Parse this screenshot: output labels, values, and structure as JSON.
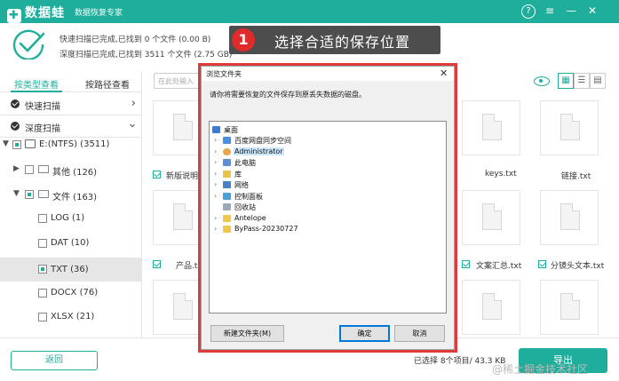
{
  "app": {
    "name": "数据蛙",
    "subtitle": "数据恢复专家"
  },
  "window_controls": {
    "help": "?",
    "menu": "≡",
    "minimize": "—",
    "close": "✕"
  },
  "scan": {
    "quick_status": "快速扫描已完成,已找到 0 个文件 (0.00  B)",
    "deep_status": "深度扫描已完成,已找到 3511 个文件 (2.75 GB)"
  },
  "callout": {
    "number": "1",
    "text": "选择合适的保存位置"
  },
  "sidebar": {
    "tabs": [
      "按类型查看",
      "按路径查看"
    ],
    "quick_scan": "快速扫描",
    "deep_scan": "深度扫描",
    "tree": [
      {
        "label": "E:(NTFS) (3511)"
      },
      {
        "label": "其他 (126)"
      },
      {
        "label": "文件 (163)"
      },
      {
        "label": "LOG (1)"
      },
      {
        "label": "DAT (10)"
      },
      {
        "label": "TXT (36)"
      },
      {
        "label": "DOCX (76)"
      },
      {
        "label": "XLSX (21)"
      }
    ]
  },
  "toolbar": {
    "search_placeholder": "在此处输入",
    "view_grid": "▦",
    "view_list": "☰",
    "view_detail": "▤"
  },
  "files": [
    {
      "name": "新版说明..."
    },
    {
      "name": "keys.txt"
    },
    {
      "name": "链接.txt"
    },
    {
      "name": "产品.txt"
    },
    {
      "name": "文案汇总.txt"
    },
    {
      "name": "分镜头文本.txt"
    }
  ],
  "dialog": {
    "title": "浏览文件夹",
    "close": "✕",
    "instruction": "请你将需要恢复的文件保存到原丢失数据的磁盘。",
    "tree_root": "桌面",
    "tree_items": [
      {
        "label": "百度网盘同步空间",
        "color": "#4a90e2"
      },
      {
        "label": "Administrator",
        "color": "#e8a64a"
      },
      {
        "label": "此电脑",
        "color": "#5b8fd6"
      },
      {
        "label": "库",
        "color": "#e8c34a"
      },
      {
        "label": "网络",
        "color": "#4a7fc9"
      },
      {
        "label": "控制面板",
        "color": "#4aa0d8"
      },
      {
        "label": "回收站",
        "color": "#9aa8b8"
      },
      {
        "label": "Antelope",
        "color": "#f2c84b"
      },
      {
        "label": "ByPass-20230727",
        "color": "#f2c84b"
      }
    ],
    "new_folder_button": "新建文件夹(M)",
    "ok_button": "确定",
    "cancel_button": "取消"
  },
  "bottom": {
    "back_button": "返回",
    "selection_status": "已选择 8个项目/ 43.3 KB",
    "export_button": "导出",
    "watermark": "@稀土掘金技术社区"
  },
  "colors": {
    "accent": "#1fae9c",
    "highlight_border": "#e03a3a",
    "callout_bg": "#4d4d4d"
  }
}
